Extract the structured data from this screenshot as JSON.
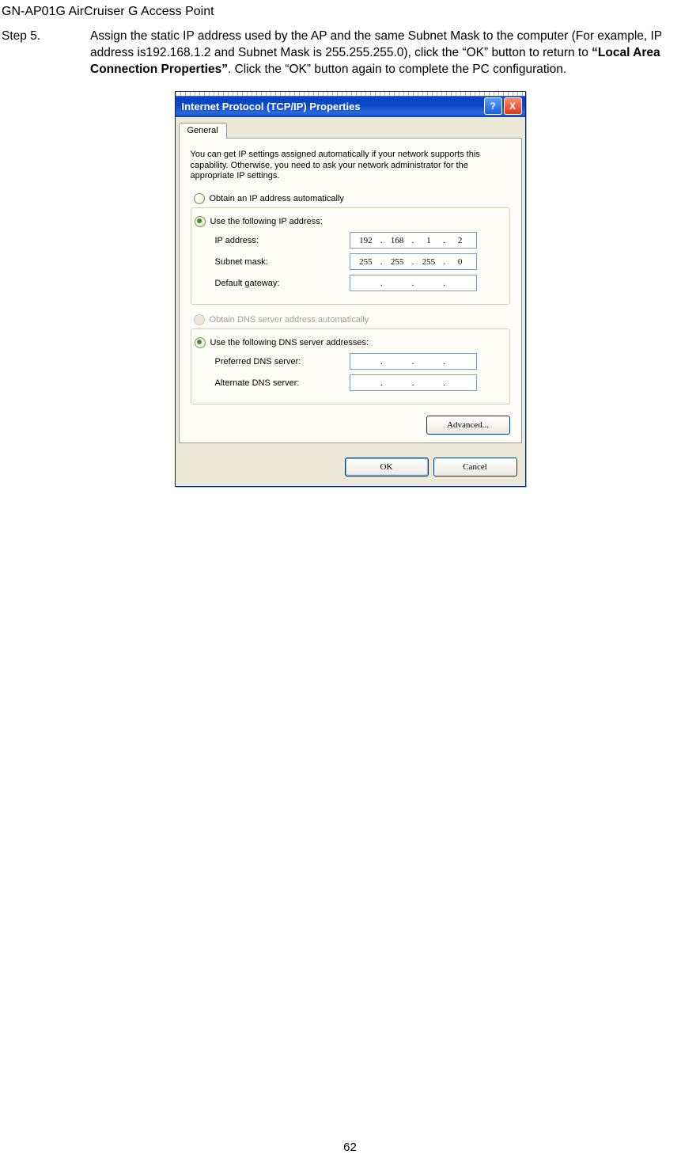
{
  "doc_title": "GN-AP01G AirCruiser G Access Point",
  "step": {
    "label": "Step 5.",
    "text_before_bold": "Assign the static IP address used by the AP and the same Subnet Mask to the computer (For example, IP address is192.168.1.2 and Subnet Mask is 255.255.255.0), click the “OK” button to return to ",
    "bold": "“Local Area Connection Properties”",
    "text_after_bold": ". Click the “OK” button again to complete the PC configuration."
  },
  "dialog": {
    "title": "Internet Protocol (TCP/IP) Properties",
    "help_glyph": "?",
    "close_glyph": "X",
    "tab_label": "General",
    "intro": "You can get IP settings assigned automatically if your network supports this capability. Otherwise, you need to ask your network administrator for the appropriate IP settings.",
    "radio_obtain_ip": "Obtain an IP address automatically",
    "radio_use_ip": "Use the following IP address:",
    "ip_address_label": "IP address:",
    "ip_address_value": [
      "192",
      "168",
      "1",
      "2"
    ],
    "subnet_label": "Subnet mask:",
    "subnet_value": [
      "255",
      "255",
      "255",
      "0"
    ],
    "gateway_label": "Default gateway:",
    "radio_obtain_dns": "Obtain DNS server address automatically",
    "radio_use_dns": "Use the following DNS server addresses:",
    "pref_dns_label": "Preferred DNS server:",
    "alt_dns_label": "Alternate DNS server:",
    "advanced_btn": "Advanced...",
    "ok_btn": "OK",
    "cancel_btn": "Cancel"
  },
  "page_number": "62"
}
